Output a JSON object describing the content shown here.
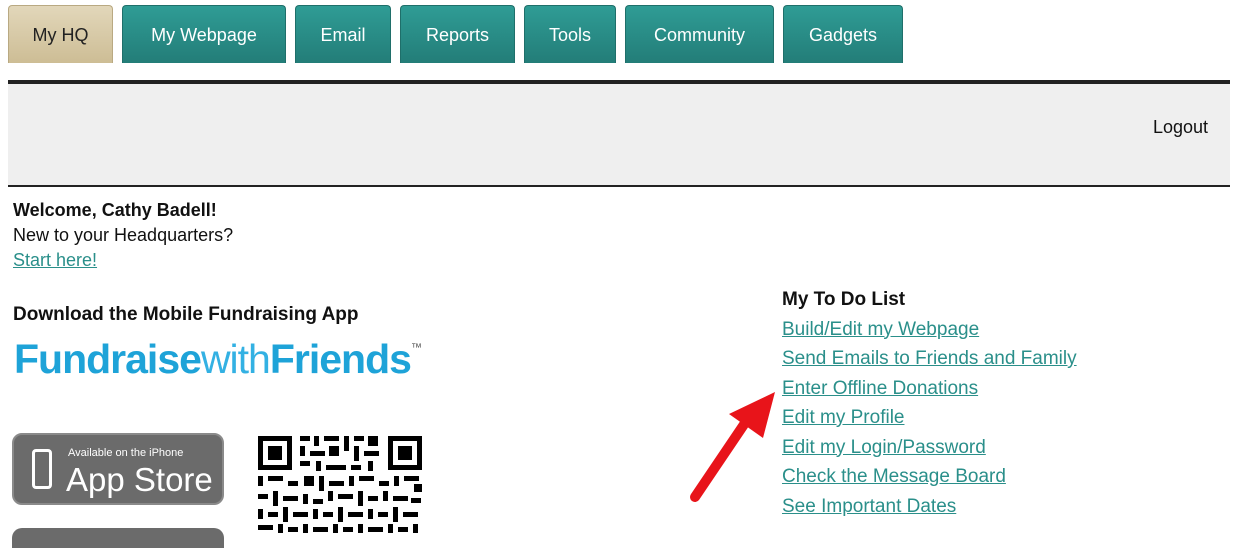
{
  "tabs": [
    {
      "label": "My HQ",
      "active": true
    },
    {
      "label": "My Webpage",
      "active": false
    },
    {
      "label": "Email",
      "active": false
    },
    {
      "label": "Reports",
      "active": false
    },
    {
      "label": "Tools",
      "active": false
    },
    {
      "label": "Community",
      "active": false
    },
    {
      "label": "Gadgets",
      "active": false
    }
  ],
  "header": {
    "logout_label": "Logout"
  },
  "welcome": {
    "greeting": "Welcome, Cathy Badell!",
    "question": "New to your Headquarters?",
    "start_link": "Start here!"
  },
  "mobile_app": {
    "title": "Download the Mobile Fundraising App",
    "brand": {
      "word1": "Fundraise",
      "word2": "with",
      "word3": "Friends",
      "tm": "™"
    },
    "appstore": {
      "small_text": "Available on the iPhone",
      "big_text": "App Store"
    }
  },
  "todo": {
    "title": "My To Do List",
    "items": [
      "Build/Edit my Webpage",
      "Send Emails to Friends and Family",
      "Enter Offline Donations",
      "Edit my Profile",
      "Edit my Login/Password",
      "Check the Message Board",
      "See Important Dates"
    ]
  },
  "colors": {
    "tab_bg": "#2a8f8a",
    "tab_active_bg": "#d8cba8",
    "link": "#2a8f8a",
    "brand_blue": "#1ea3d8",
    "arrow": "#e8141a"
  }
}
